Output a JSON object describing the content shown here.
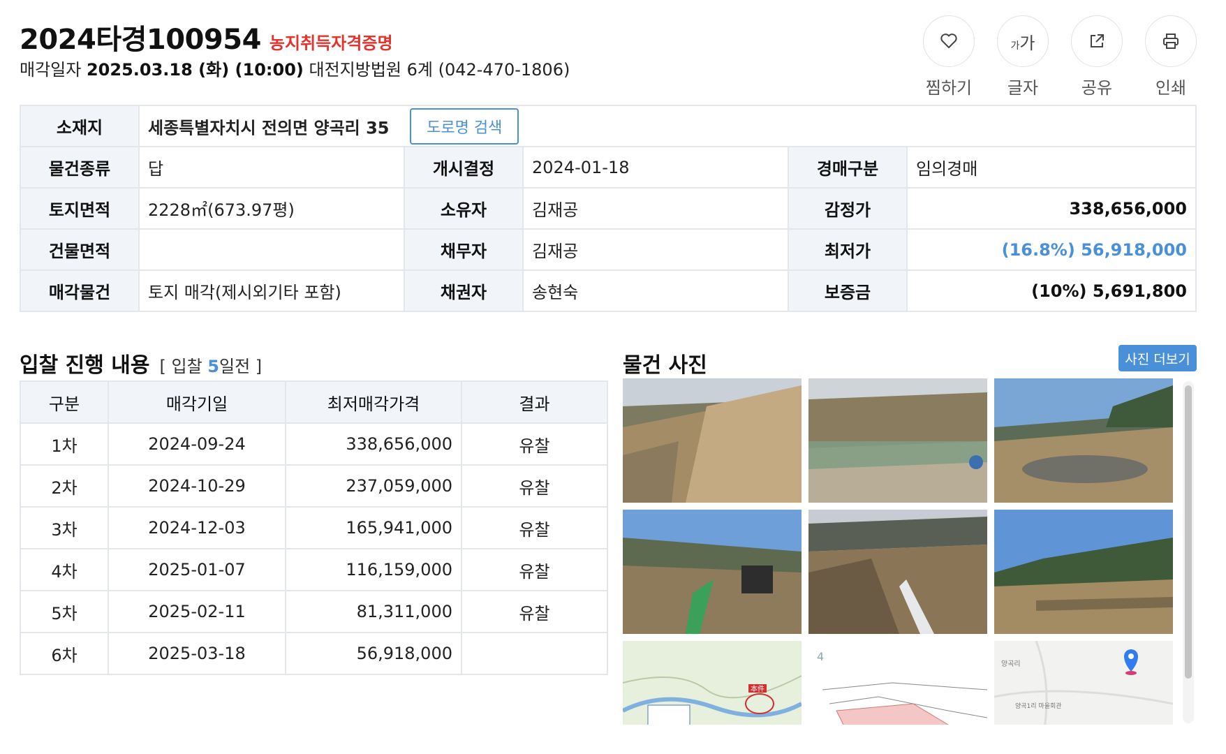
{
  "header": {
    "case_number": "2024타경100954",
    "flag": "농지취득자격증명",
    "sale_date_label": "매각일자",
    "sale_date": "2025.03.18 (화) (10:00)",
    "court": "대전지방법원 6계 (042-470-1806)"
  },
  "actions": [
    {
      "label": "찜하기",
      "icon": "heart-icon"
    },
    {
      "label": "글자",
      "icon": "font-size-icon",
      "glyph_small": "가",
      "glyph_big": "가"
    },
    {
      "label": "공유",
      "icon": "share-icon"
    },
    {
      "label": "인쇄",
      "icon": "print-icon"
    }
  ],
  "info": {
    "location_label": "소재지",
    "location": "세종특별자치시 전의면 양곡리 35",
    "road_search": "도로명 검색",
    "rows": [
      {
        "l1": "물건종류",
        "v1": "답",
        "l2": "개시결정",
        "v2": "2024-01-18",
        "l3": "경매구분",
        "v3": "임의경매"
      },
      {
        "l1": "토지면적",
        "v1": "2228㎡(673.97평)",
        "l2": "소유자",
        "v2": "김재공",
        "l3": "감정가",
        "v3": "338,656,000"
      },
      {
        "l1": "건물면적",
        "v1": "",
        "l2": "채무자",
        "v2": "김재공",
        "l3": "최저가",
        "v3": "(16.8%) 56,918,000"
      },
      {
        "l1": "매각물건",
        "v1": "토지 매각(제시외기타 포함)",
        "l2": "채권자",
        "v2": "송현숙",
        "l3": "보증금",
        "v3": "(10%) 5,691,800"
      }
    ]
  },
  "bids": {
    "title": "입찰 진행 내용",
    "sub_prefix": "[ 입찰 ",
    "days": "5",
    "sub_suffix": "일전 ]",
    "columns": [
      "구분",
      "매각기일",
      "최저매각가격",
      "결과"
    ],
    "rows": [
      {
        "round": "1차",
        "date": "2024-09-24",
        "price": "338,656,000",
        "result": "유찰"
      },
      {
        "round": "2차",
        "date": "2024-10-29",
        "price": "237,059,000",
        "result": "유찰"
      },
      {
        "round": "3차",
        "date": "2024-12-03",
        "price": "165,941,000",
        "result": "유찰"
      },
      {
        "round": "4차",
        "date": "2025-01-07",
        "price": "116,159,000",
        "result": "유찰"
      },
      {
        "round": "5차",
        "date": "2025-02-11",
        "price": "81,311,000",
        "result": "유찰"
      },
      {
        "round": "6차",
        "date": "2025-03-18",
        "price": "56,918,000",
        "result": ""
      }
    ]
  },
  "photos": {
    "title": "물건 사진",
    "more": "사진 더보기",
    "map_label_a": "本件",
    "map_label_b": "양곡리",
    "map_label_c": "양곡1리 마을회관"
  }
}
